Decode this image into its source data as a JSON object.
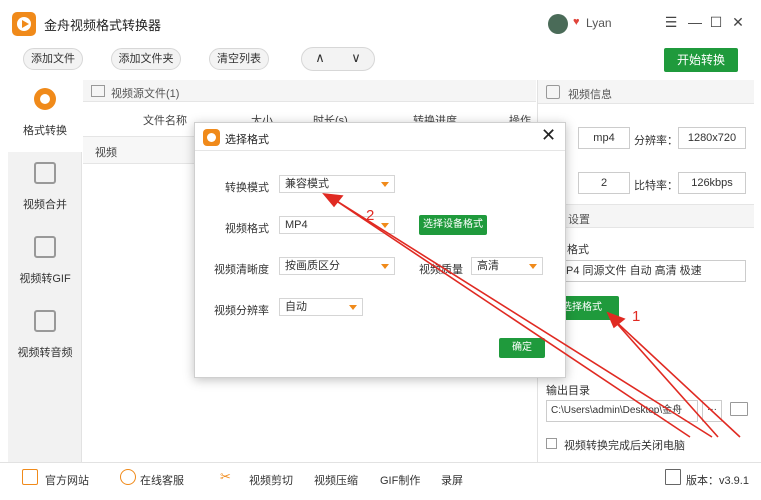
{
  "app": {
    "title": "金舟视频格式转换器",
    "username": "Lyan",
    "window_controls": [
      "☰",
      "—",
      "☐",
      "✕"
    ]
  },
  "toolbar": {
    "add_file": "添加文件",
    "add_folder": "添加文件夹",
    "clear_list": "清空列表",
    "up": "∧",
    "down": "∨",
    "start": "开始转换"
  },
  "nav": [
    {
      "label": "格式转换",
      "active": true
    },
    {
      "label": "视频合并"
    },
    {
      "label": "视频转GIF"
    },
    {
      "label": "视频转音频"
    }
  ],
  "file_panel": {
    "header": "视频源文件(1)",
    "columns": {
      "name": "文件名称",
      "size": "大小",
      "duration": "时长(s)",
      "progress": "转换进度",
      "action": "操作"
    },
    "row": {
      "name": "视频"
    }
  },
  "info_panel": {
    "header": "视频信息",
    "format_value": "mp4",
    "resolution_label": "分辨率：",
    "resolution_value": "1280x720",
    "row2_value": "2",
    "bitrate_label": "比特率：",
    "bitrate_value": "126kbps",
    "settings_header": "设置",
    "format_label": "格式",
    "format_summary": "P4 同源文件 自动 高清 极速",
    "select_format_btn": "选择格式",
    "output_dir_label": "输出目录",
    "output_dir_value": "C:\\Users\\admin\\Desktop\\金舟",
    "more_btn": "···",
    "shutdown_label": "视频转换完成后关闭电脑"
  },
  "footer": {
    "website": "官方网站",
    "support": "在线客服",
    "clip": "视频剪切",
    "compress": "视频压缩",
    "gif": "GIF制作",
    "record": "录屏",
    "version": "版本：v3.9.1"
  },
  "modal": {
    "title": "选择格式",
    "close": "✕",
    "mode_label": "转换模式",
    "mode_value": "兼容模式",
    "format_label": "视频格式",
    "format_value": "MP4",
    "device_btn": "选择设备格式",
    "clarity_label": "视频清晰度",
    "clarity_value": "按画质区分",
    "quality_label": "视频质量",
    "quality_value": "高清",
    "resolution_label": "视频分辨率",
    "resolution_value": "自动",
    "confirm": "确定"
  },
  "annotations": {
    "step1": "1",
    "step2": "2",
    "color": "#e02a22"
  }
}
